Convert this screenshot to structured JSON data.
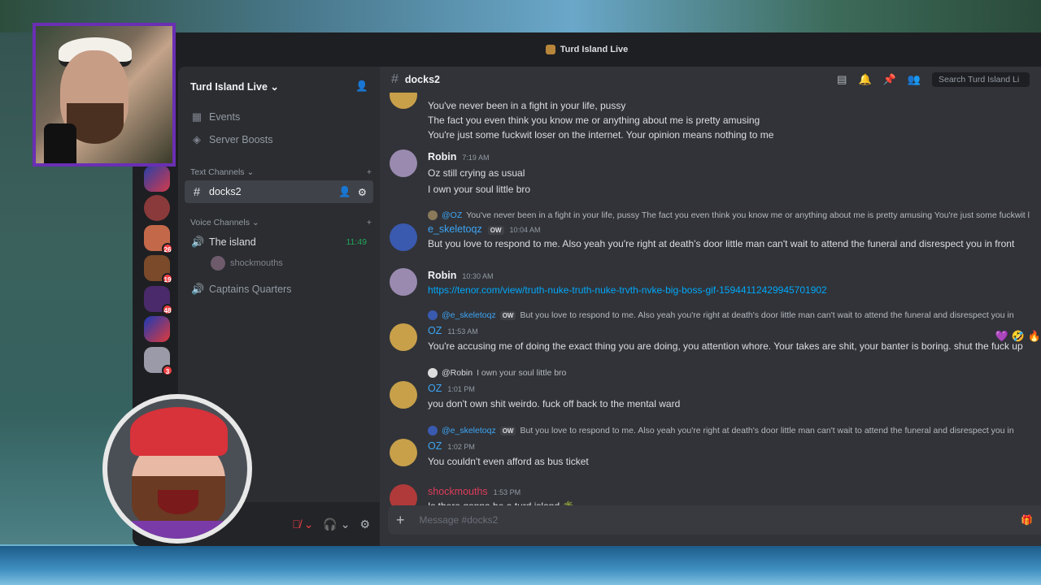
{
  "window": {
    "title": "Turd Island Live"
  },
  "server": {
    "name": "Turd Island Live"
  },
  "sidebar": {
    "top_items": [
      {
        "label": "Events",
        "icon": "calendar-icon"
      },
      {
        "label": "Server Boosts",
        "icon": "boost-icon"
      }
    ],
    "text_category": "Text Channels",
    "text_channels": [
      {
        "label": "docks2",
        "active": true
      }
    ],
    "voice_category": "Voice Channels",
    "voice_channels": [
      {
        "label": "The island",
        "timer": "11:49",
        "users": [
          "shockmouths"
        ]
      },
      {
        "label": "Captains Quarters"
      }
    ]
  },
  "guild_badges": [
    "26",
    "19",
    "48",
    "3"
  ],
  "chat": {
    "channel": "docks2",
    "search_placeholder": "Search Turd Island Li",
    "messages": [
      {
        "lines": [
          "You've never been in a fight in your life, pussy",
          "The fact you even think you know me or anything about me is pretty amusing",
          "You're just some fuckwit loser on the internet. Your opinion means nothing to me"
        ]
      },
      {
        "author": "Robin",
        "time": "7:19 AM",
        "lines": [
          "Oz still crying as usual",
          "I own your soul little bro"
        ]
      },
      {
        "reply_to": "@OZ",
        "reply_text": "You've never been in a fight in your life, pussy The fact you even think you know me or anything about me is pretty amusing You're just some fuckwit l",
        "author": "e_skeletoqz",
        "tag": "OW",
        "time": "10:04 AM",
        "lines": [
          "But you love to respond to me. Also yeah you're right at death's door little man can't wait to attend the funeral and disrespect you in front"
        ]
      },
      {
        "author": "Robin",
        "time": "10:30 AM",
        "link": "https://tenor.com/view/truth-nuke-truth-nuke-trvth-nvke-big-boss-gif-15944112429945701902"
      },
      {
        "reply_to": "@e_skeletoqz",
        "reply_tag": "OW",
        "reply_text": "But you love to respond to me. Also yeah you're right at death's door little man can't wait to attend the funeral and disrespect you in",
        "author": "OZ",
        "time": "11:53 AM",
        "lines": [
          "You're accusing me of doing the exact thing you are doing, you attention whore. Your takes are shit, your banter is boring. shut the fuck up"
        ]
      },
      {
        "reply_to": "@Robin",
        "reply_text": "I own your soul little bro",
        "author": "OZ",
        "time": "1:01 PM",
        "lines": [
          "you don't own shit weirdo. fuck off back to the mental ward"
        ]
      },
      {
        "reply_to": "@e_skeletoqz",
        "reply_tag": "OW",
        "reply_text": "But you love to respond to me. Also yeah you're right at death's door little man can't wait to attend the funeral and disrespect you in",
        "author": "OZ",
        "time": "1:02 PM",
        "lines": [
          "You couldn't even afford as bus ticket"
        ]
      },
      {
        "author": "shockmouths",
        "time": "1:53 PM",
        "lines": [
          "Is there gonna be a turd island 🌴"
        ]
      }
    ],
    "reactions": [
      "💜",
      "🤣",
      "🔥"
    ],
    "composer_placeholder": "Message #docks2"
  },
  "colors": {
    "accent": "#5865f2",
    "link": "#00a8fc",
    "mention": "#3da5f5",
    "voice_green": "#23a55a",
    "webcam_border": "#6a2fb3"
  }
}
